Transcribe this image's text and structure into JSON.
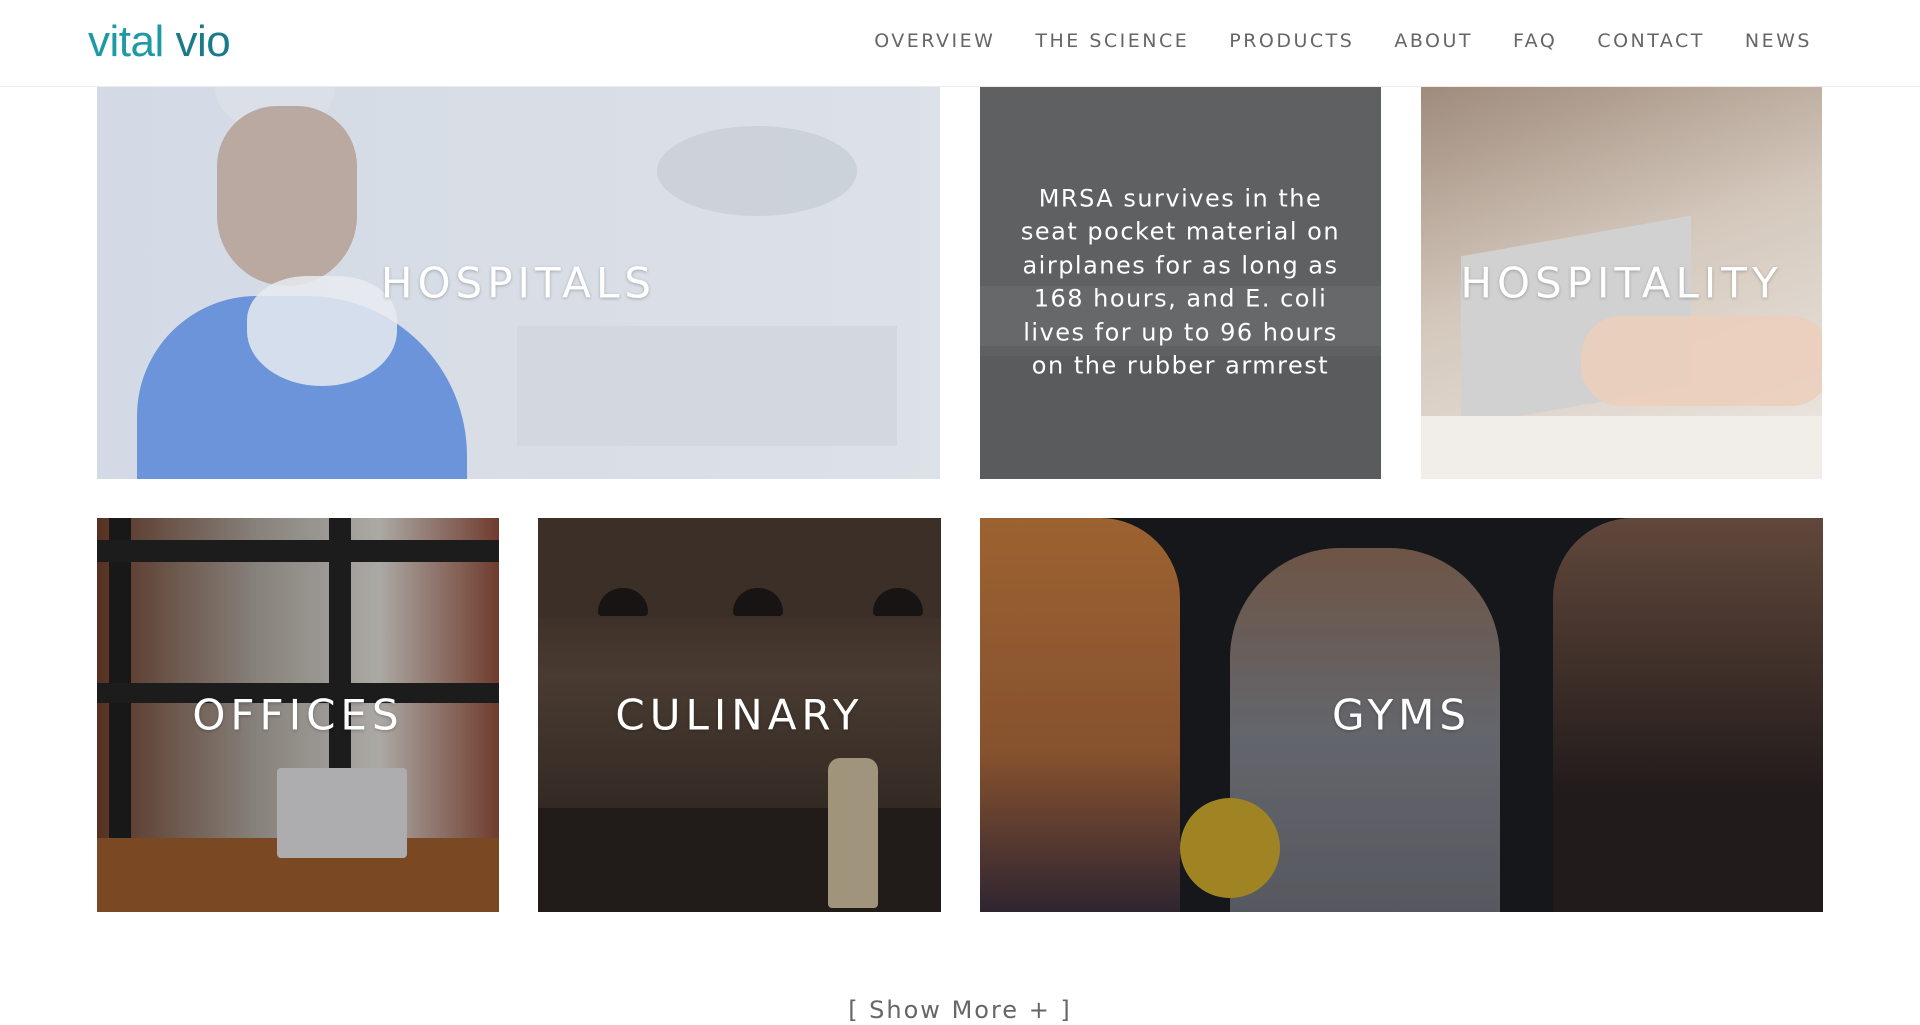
{
  "header": {
    "logo": {
      "part1": "vital",
      "part2": "vio"
    },
    "nav": [
      "OVERVIEW",
      "THE SCIENCE",
      "PRODUCTS",
      "ABOUT",
      "FAQ",
      "CONTACT",
      "NEWS"
    ]
  },
  "tiles": {
    "hospitals": "HOSPITALS",
    "quote": "MRSA survives in the seat pocket material on airplanes for as long as 168 hours, and E. coli lives for up to 96 hours on the rubber armrest",
    "hospitality": "HOSPITALITY",
    "offices": "OFFICES",
    "culinary": "CULINARY",
    "gyms": "GYMS"
  },
  "show_more": "[ Show More + ]",
  "colors": {
    "brand": "#1f9aa5",
    "brand_dark": "#1b7a8a",
    "nav_text": "#666666"
  }
}
